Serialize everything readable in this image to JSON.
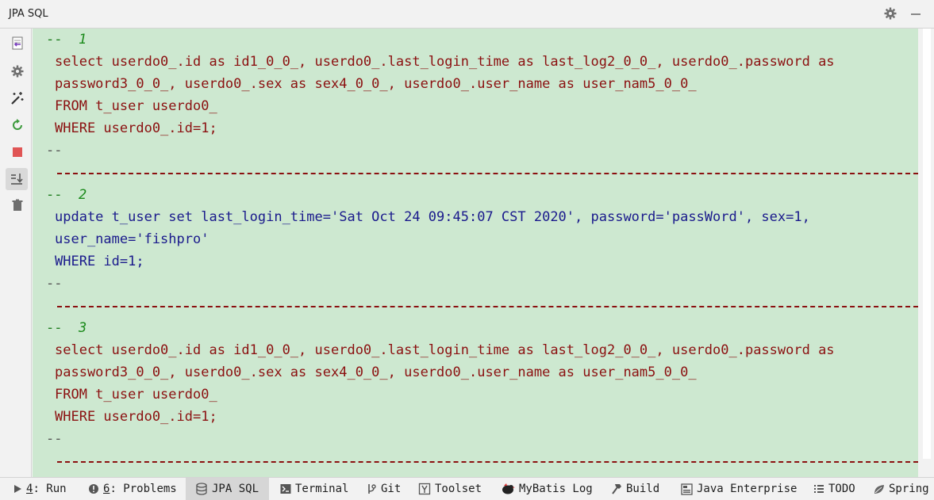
{
  "window": {
    "title": "JPA SQL"
  },
  "toolbar": {
    "settings_icon": "gear-icon",
    "minimize_icon": "minimize-icon"
  },
  "sidebar": {
    "icons": [
      "import-icon",
      "gear-icon",
      "magic-wand-icon",
      "rerun-icon",
      "stop-icon",
      "scroll-to-end-icon",
      "trash-icon"
    ]
  },
  "console": {
    "entries": [
      {
        "marker": "--",
        "number": "1",
        "lines": [
          "select userdo0_.id as id1_0_0_, userdo0_.last_login_time as last_log2_0_0_, userdo0_.password as",
          "password3_0_0_, userdo0_.sex as sex4_0_0_, userdo0_.user_name as user_nam5_0_0_",
          "FROM t_user userdo0_",
          "WHERE userdo0_.id=1;"
        ],
        "end": "--"
      },
      {
        "marker": "--",
        "number": "2",
        "lines": [
          "update t_user set last_login_time='Sat Oct 24 09:45:07 CST 2020', password='passWord', sex=1,",
          "user_name='fishpro'",
          "WHERE id=1;"
        ],
        "end": "--"
      },
      {
        "marker": "--",
        "number": "3",
        "lines": [
          "select userdo0_.id as id1_0_0_, userdo0_.last_login_time as last_log2_0_0_, userdo0_.password as",
          "password3_0_0_, userdo0_.sex as sex4_0_0_, userdo0_.user_name as user_nam5_0_0_",
          "FROM t_user userdo0_",
          "WHERE userdo0_.id=1;"
        ],
        "end": "--"
      }
    ]
  },
  "statusbar": {
    "tabs": [
      {
        "key": "4",
        "label": ": Run",
        "icon": "play-icon"
      },
      {
        "key": "6",
        "label": ": Problems",
        "icon": "problems-icon"
      },
      {
        "key": "",
        "label": "JPA SQL",
        "icon": "database-icon",
        "active": true
      },
      {
        "key": "",
        "label": "Terminal",
        "icon": "terminal-icon"
      },
      {
        "key": "",
        "label": "Git",
        "icon": "git-icon"
      },
      {
        "key": "",
        "label": "Toolset",
        "icon": "toolset-icon"
      },
      {
        "key": "",
        "label": "MyBatis Log",
        "icon": "bird-icon"
      },
      {
        "key": "",
        "label": "Build",
        "icon": "hammer-icon"
      },
      {
        "key": "",
        "label": "Java Enterprise",
        "icon": "java-enterprise-icon"
      },
      {
        "key": "",
        "label": "TODO",
        "icon": "list-icon"
      },
      {
        "key": "",
        "label": "Spring",
        "icon": "spring-leaf-icon"
      }
    ]
  },
  "colors": {
    "console_bg": "#cde8d0",
    "select_text": "#8b1010",
    "update_text": "#1a1a8c",
    "marker_number": "#1b8a1b"
  }
}
